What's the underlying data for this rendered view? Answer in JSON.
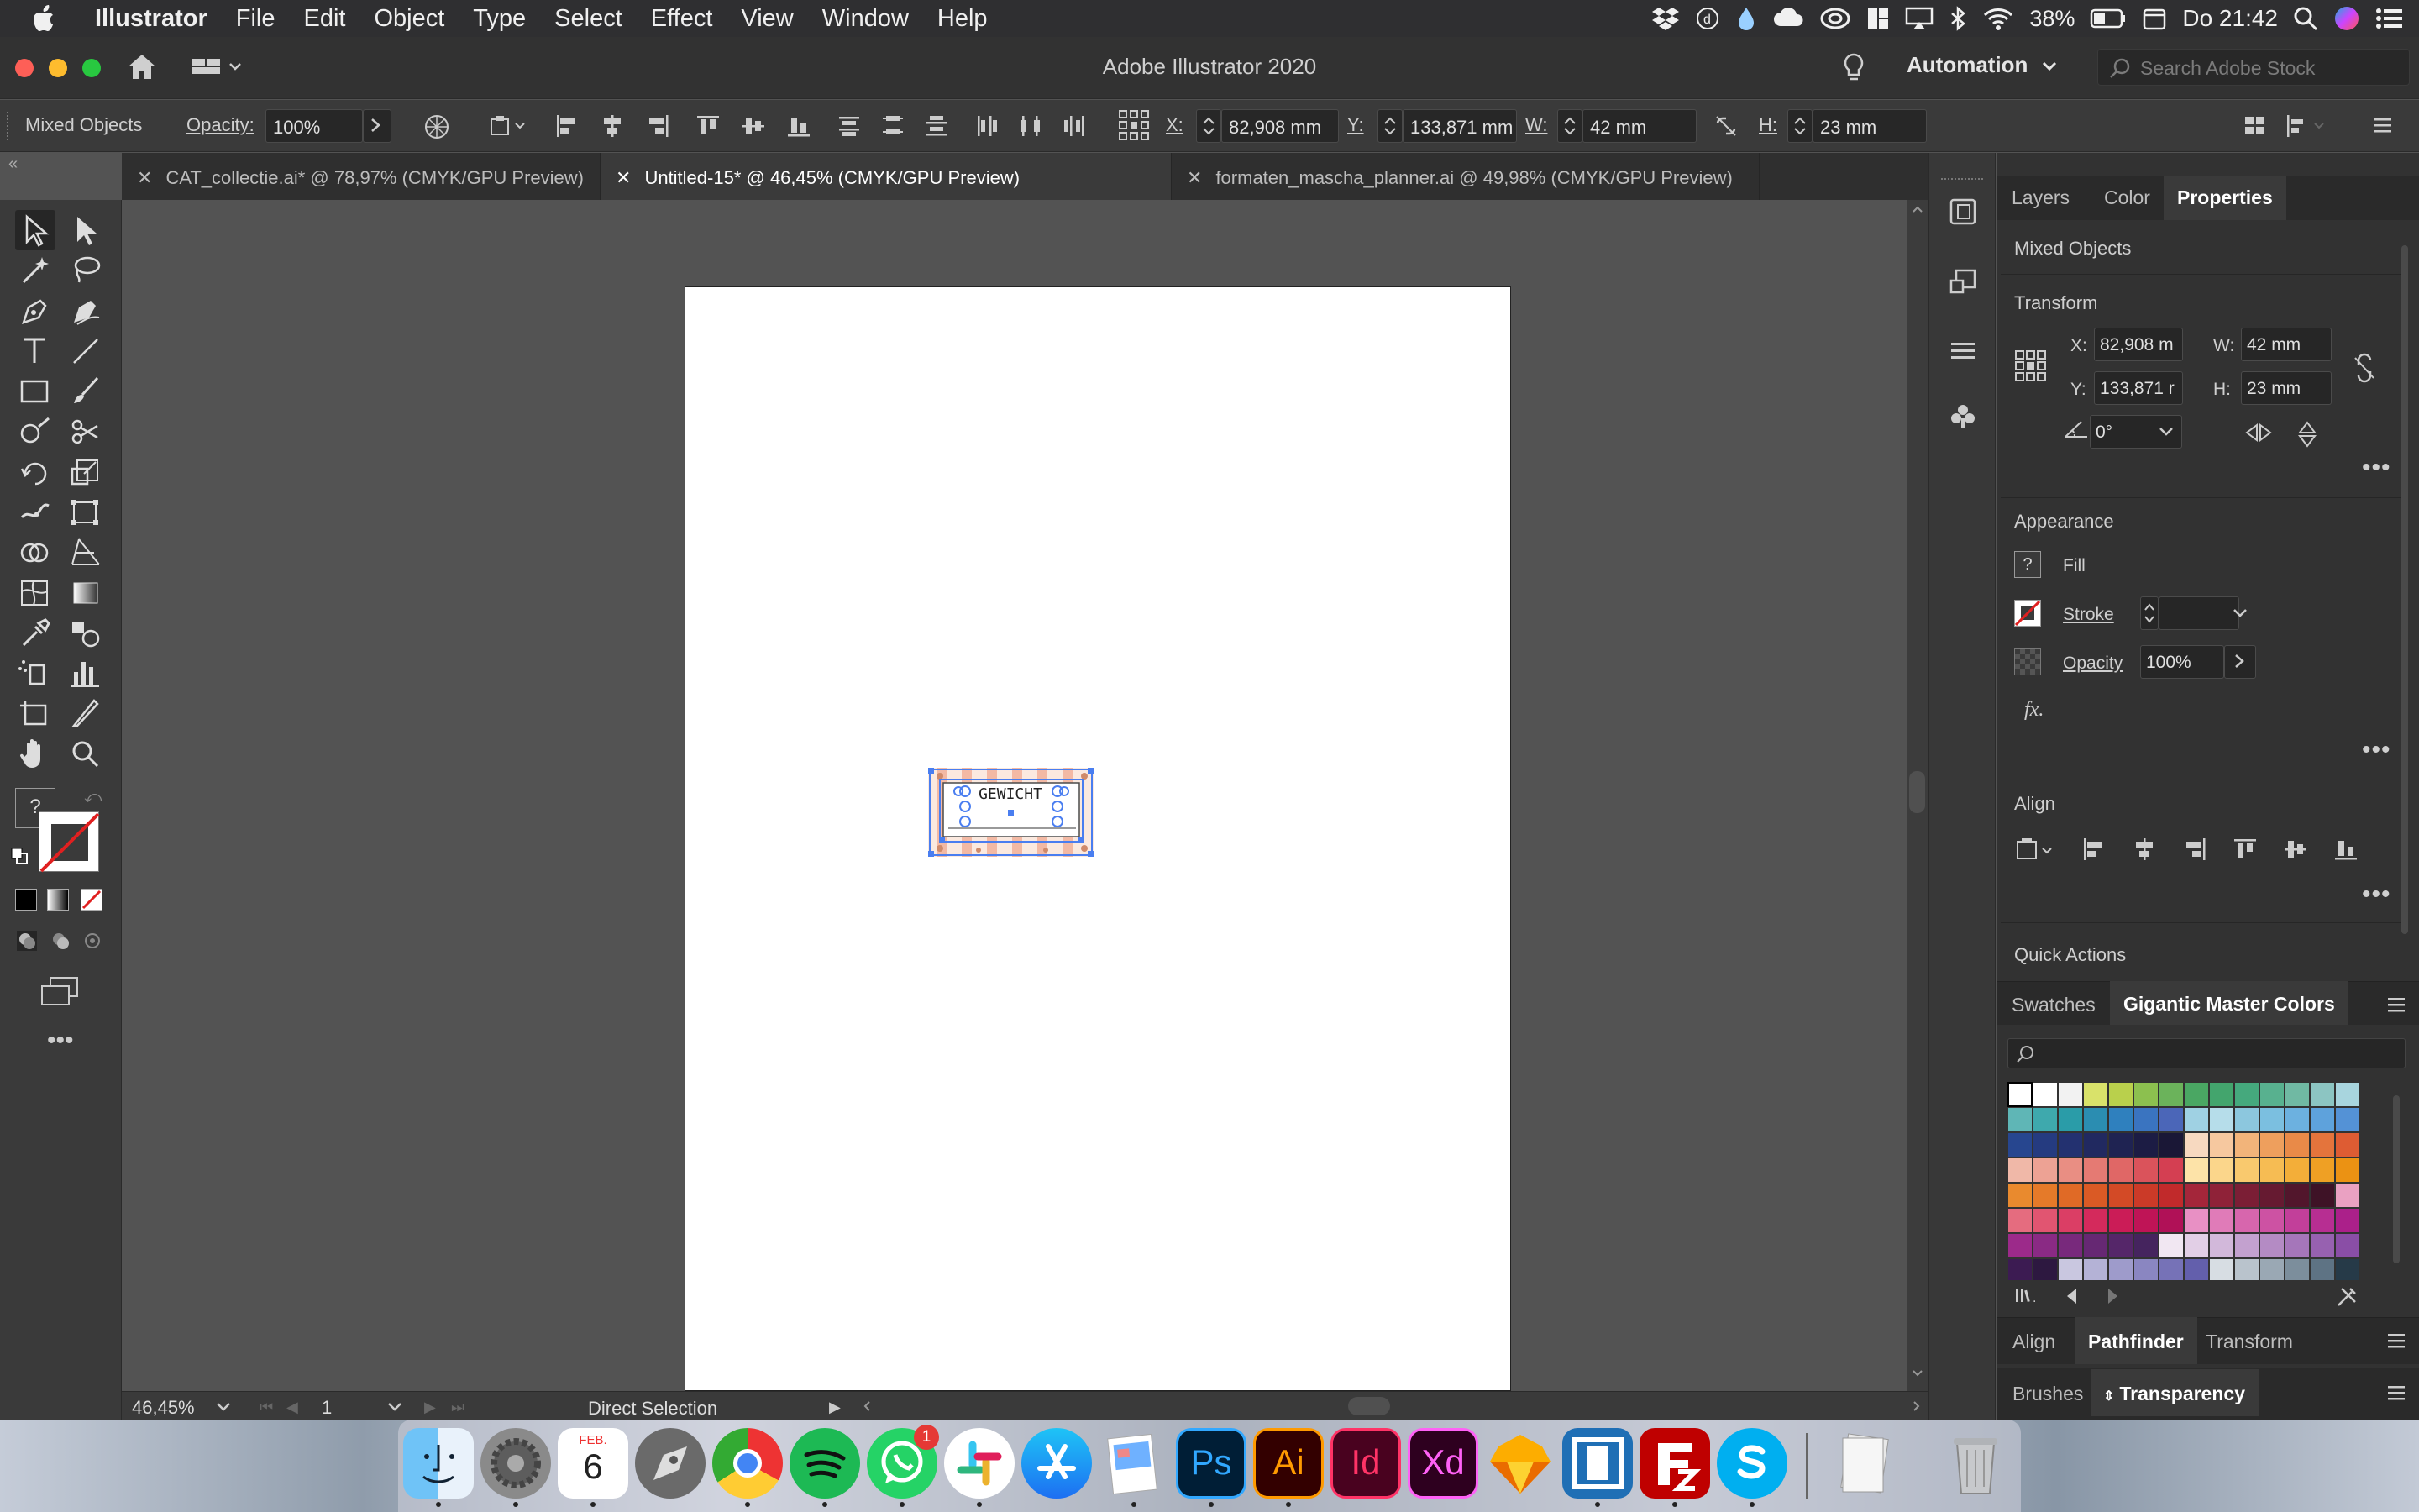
{
  "menubar": {
    "apple_icon": "apple-icon",
    "app_name": "Illustrator",
    "items": [
      "File",
      "Edit",
      "Object",
      "Type",
      "Select",
      "Effect",
      "View",
      "Window",
      "Help"
    ],
    "battery": "38%",
    "clock": "Do 21:42"
  },
  "window": {
    "title": "Adobe Illustrator 2020",
    "workspace": "Automation",
    "search_placeholder": "Search Adobe Stock"
  },
  "control_bar": {
    "selection": "Mixed Objects",
    "opacity_label": "Opacity:",
    "opacity_value": "100%",
    "x_label": "X:",
    "x_value": "82,908 mm",
    "y_label": "Y:",
    "y_value": "133,871 mm",
    "w_label": "W:",
    "w_value": "42 mm",
    "h_label": "H:",
    "h_value": "23 mm"
  },
  "tabs": [
    {
      "label": "CAT_collectie.ai* @ 78,97% (CMYK/GPU Preview)"
    },
    {
      "label": "Untitled-15* @ 46,45% (CMYK/GPU Preview)"
    },
    {
      "label": "formaten_mascha_planner.ai @ 49,98% (CMYK/GPU Preview)"
    }
  ],
  "artwork": {
    "label": "GEWICHT"
  },
  "status": {
    "zoom": "46,45%",
    "page": "1",
    "tool": "Direct Selection"
  },
  "panel": {
    "tabs": [
      "Layers",
      "Color",
      "Properties"
    ],
    "selection": "Mixed Objects",
    "transform_title": "Transform",
    "x_label": "X:",
    "x_value": "82,908 m",
    "y_label": "Y:",
    "y_value": "133,871 r",
    "w_label": "W:",
    "w_value": "42 mm",
    "h_label": "H:",
    "h_value": "23 mm",
    "angle_value": "0°",
    "appearance_title": "Appearance",
    "fill_label": "Fill",
    "stroke_label": "Stroke",
    "opacity_label": "Opacity",
    "opacity_value": "100%",
    "fx_label": "fx.",
    "align_title": "Align",
    "quick_actions_title": "Quick Actions",
    "fill_unknown": "?"
  },
  "swatches_panel": {
    "tabs": [
      "Swatches",
      "Gigantic Master Colors"
    ]
  },
  "bottom_panels": {
    "row1": [
      "Align",
      "Pathfinder",
      "Transform"
    ],
    "row2": [
      "Brushes",
      "Transparency"
    ]
  },
  "toolbar": {
    "fill_unknown": "?"
  },
  "dock": {
    "calendar_month": "FEB.",
    "calendar_day": "6",
    "whatsapp_badge": "1",
    "ps": "Ps",
    "ai": "Ai",
    "id": "Id",
    "xd": "Xd"
  },
  "swatch_colors": [
    [
      "#ffffff",
      "#ffffff",
      "#f2f2f2",
      "#d9e26a",
      "#b9d04c",
      "#8cc04f",
      "#6bb35b",
      "#4aa763",
      "#43a56d",
      "#45a97d",
      "#58b18f",
      "#70b9a3",
      "#8cc5c2",
      "#a8d5de"
    ],
    [
      "#5fb6b6",
      "#3ea9ad",
      "#2a9ca8",
      "#2b8db1",
      "#2f80be",
      "#3a74c0",
      "#4b66b8",
      "#9fd1e3",
      "#b6ddea",
      "#8cc7de",
      "#7bbfe0",
      "#6cb1e0",
      "#5ea2dc",
      "#5492d6"
    ],
    [
      "#27468f",
      "#253b80",
      "#233170",
      "#212960",
      "#1f2352",
      "#1c1c44",
      "#1a1736",
      "#f7d9c0",
      "#f6c89f",
      "#f2b47a",
      "#ee9f5d",
      "#e98a48",
      "#e4743c",
      "#de5c33"
    ],
    [
      "#f0b8a8",
      "#eda294",
      "#e98e83",
      "#e57a73",
      "#e06766",
      "#da535b",
      "#d43f52",
      "#fde3a8",
      "#fbd68b",
      "#f9c96e",
      "#f6bc53",
      "#f3ae39",
      "#efa024",
      "#eb9213"
    ],
    [
      "#e98a2e",
      "#e57a29",
      "#e06a26",
      "#da5a25",
      "#d34a26",
      "#cb3a28",
      "#c12a2b",
      "#a4263a",
      "#8f2238",
      "#7b1e35",
      "#661a31",
      "#52162c",
      "#3e1226",
      "#eaa1c2"
    ],
    [
      "#e56c7f",
      "#e15571",
      "#db3e65",
      "#d42a5c",
      "#cb1c57",
      "#bf1456",
      "#b01157",
      "#e890c4",
      "#e07bb8",
      "#d766ad",
      "#cd52a3",
      "#c23f9a",
      "#b72e92",
      "#ab208a"
    ],
    [
      "#9c2a8a",
      "#8a2a84",
      "#78297c",
      "#662873",
      "#552669",
      "#45245e",
      "#f1e7f2",
      "#e2cfe6",
      "#d2b8da",
      "#c3a1cf",
      "#b48bc4",
      "#a576ba",
      "#9761b0",
      "#8a4ea6"
    ],
    [
      "#3c1b52",
      "#2d1840",
      "#c9c7e0",
      "#b4b2d6",
      "#9e9bcb",
      "#8a86c1",
      "#7672b7",
      "#635fac",
      "#d7dde3",
      "#b9c3cc",
      "#9aa8b4",
      "#7c8e9c",
      "#5e7384",
      "#263a48"
    ]
  ]
}
